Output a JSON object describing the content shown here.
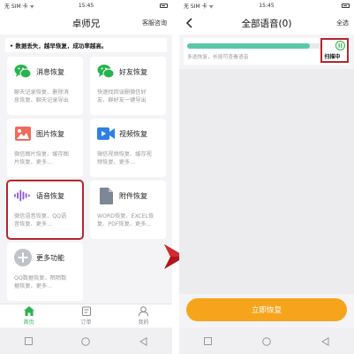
{
  "left": {
    "status": {
      "carrier": "无 SIM 卡 ᯤ",
      "time": "15:45"
    },
    "title": "卓师兄",
    "service_label": "客服咨询",
    "banner": "• 数据丢失，越早恢复，成功率越高。",
    "cards": [
      {
        "title": "消息恢复",
        "desc1": "聊天记录恢复、删除消",
        "desc2": "息恢复、聊天记录导出"
      },
      {
        "title": "好友恢复",
        "desc1": "快速找回误删微信好",
        "desc2": "友、群好友一键导出"
      },
      {
        "title": "图片恢复",
        "desc1": "微信图片恢复、缓存图",
        "desc2": "片恢复、更多…"
      },
      {
        "title": "视频恢复",
        "desc1": "微信视频恢复、缓存视",
        "desc2": "频恢复、更多…"
      },
      {
        "title": "语音恢复",
        "desc1": "微信语音恢复、QQ语",
        "desc2": "音恢复、更多…"
      },
      {
        "title": "附件恢复",
        "desc1": "WORD恢复、EXCEL恢",
        "desc2": "复、PDF恢复、更多…"
      },
      {
        "title": "更多功能",
        "desc1": "QQ数据恢复、陌陌数",
        "desc2": "据恢复、更多…"
      }
    ],
    "tabs": [
      {
        "label": "首页",
        "icon": "home-icon"
      },
      {
        "label": "订单",
        "icon": "order-icon"
      },
      {
        "label": "我的",
        "icon": "profile-icon"
      }
    ]
  },
  "right": {
    "status": {
      "carrier": "无 SIM 卡 ᯤ",
      "time": "15:45"
    },
    "title": "全部语音(0)",
    "select_all": "全选",
    "scan_hint": "多选恢复，长按可查看语音",
    "scan_status": "扫描中",
    "progress": 0.9,
    "cta": "立即恢复"
  },
  "colors": {
    "brand_green": "#27b34f",
    "progress": "#5bc8a8",
    "cta_orange": "#f7a41d",
    "highlight_red": "#b3272d"
  }
}
